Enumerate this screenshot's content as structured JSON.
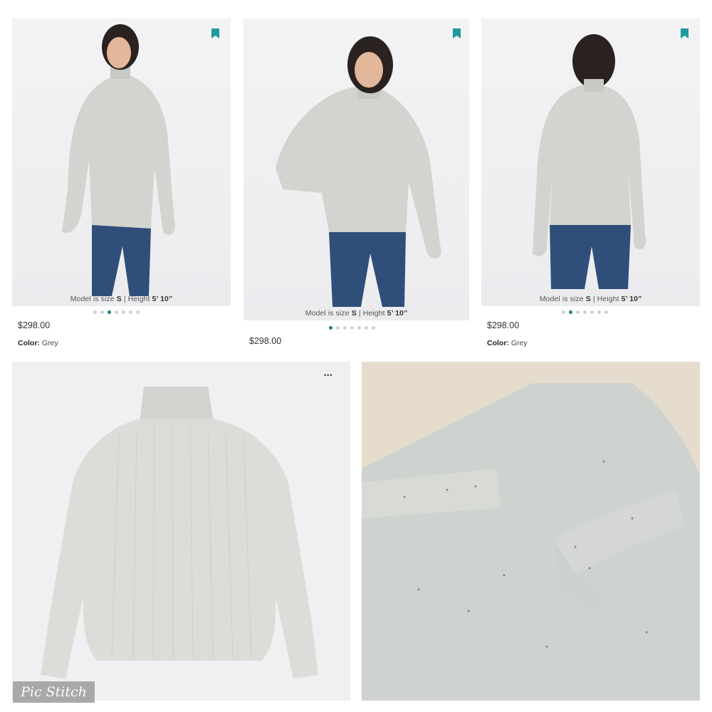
{
  "panels": [
    {
      "caption": {
        "prefix": "Model is size ",
        "size": "S",
        "sep": " | Height ",
        "height": "5’ 10”"
      },
      "dots": {
        "count": 7,
        "active": 3
      },
      "price": "$298.00",
      "color": {
        "label": "Color:",
        "value": "Grey"
      }
    },
    {
      "caption": {
        "prefix": "Model is size ",
        "size": "S",
        "sep": " | Height ",
        "height": "5’ 10”"
      },
      "dots": {
        "count": 7,
        "active": 1
      },
      "price": "$298.00"
    },
    {
      "caption": {
        "prefix": "Model is size ",
        "size": "S",
        "sep": " | Height ",
        "height": "5’ 10”"
      },
      "dots": {
        "count": 7,
        "active": 2
      },
      "price": "$298.00",
      "color": {
        "label": "Color:",
        "value": "Grey"
      }
    }
  ],
  "flatlay": {
    "more_icon": "more-horizontal-icon",
    "more_glyph": "•••"
  },
  "watermark": {
    "text": "Pic Stitch"
  },
  "colors": {
    "accent": "#1e7f85",
    "sweater": "#d6d6d2",
    "denim": "#2f4f7a"
  }
}
